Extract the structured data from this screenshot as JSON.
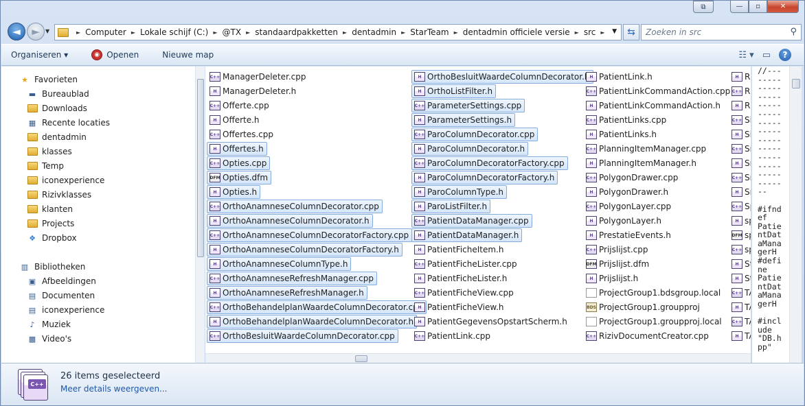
{
  "window": {
    "caption_buttons": {
      "restore_alt": "⧉",
      "minimize": "—",
      "maximize": "▫",
      "close": "✕"
    }
  },
  "nav": {
    "back_glyph": "◄",
    "forward_glyph": "►",
    "breadcrumb": [
      "Computer",
      "Lokale schijf (C:)",
      "@TX",
      "standaardpakketten",
      "dentadmin",
      "StarTeam",
      "dentadmin officiele versie",
      "src"
    ],
    "search_placeholder": "Zoeken in src"
  },
  "toolbar": {
    "organize_label": "Organiseren ▾",
    "open_label": "Openen",
    "new_folder_label": "Nieuwe map"
  },
  "navpane": {
    "favorites_header": "Favorieten",
    "favorites": [
      {
        "label": "Bureaublad",
        "icon": "desktop-icon"
      },
      {
        "label": "Downloads",
        "icon": "downloads-icon"
      },
      {
        "label": "Recente locaties",
        "icon": "recent-places-icon"
      },
      {
        "label": "dentadmin",
        "icon": "folder-icon"
      },
      {
        "label": "klasses",
        "icon": "folder-icon"
      },
      {
        "label": "Temp",
        "icon": "folder-icon"
      },
      {
        "label": "iconexperience",
        "icon": "folder-icon"
      },
      {
        "label": "Rizivklasses",
        "icon": "folder-icon"
      },
      {
        "label": "klanten",
        "icon": "folder-icon"
      },
      {
        "label": "Projects",
        "icon": "folder-icon"
      },
      {
        "label": "Dropbox",
        "icon": "dropbox-icon"
      }
    ],
    "libraries_header": "Bibliotheken",
    "libraries": [
      {
        "label": "Afbeeldingen",
        "icon": "pictures-icon"
      },
      {
        "label": "Documenten",
        "icon": "documents-icon"
      },
      {
        "label": "iconexperience",
        "icon": "documents-icon"
      },
      {
        "label": "Muziek",
        "icon": "music-icon"
      },
      {
        "label": "Video's",
        "icon": "video-icon"
      }
    ]
  },
  "files": {
    "col1": [
      {
        "name": "ManagerDeleter.cpp",
        "type": "cpp",
        "sel": false
      },
      {
        "name": "ManagerDeleter.h",
        "type": "h",
        "sel": false
      },
      {
        "name": "Offerte.cpp",
        "type": "cpp",
        "sel": false
      },
      {
        "name": "Offerte.h",
        "type": "h",
        "sel": false
      },
      {
        "name": "Offertes.cpp",
        "type": "cpp",
        "sel": false
      },
      {
        "name": "Offertes.h",
        "type": "h",
        "sel": true
      },
      {
        "name": "Opties.cpp",
        "type": "cpp",
        "sel": true
      },
      {
        "name": "Opties.dfm",
        "type": "dfm",
        "sel": true
      },
      {
        "name": "Opties.h",
        "type": "h",
        "sel": true
      },
      {
        "name": "OrthoAnamneseColumnDecorator.cpp",
        "type": "cpp",
        "sel": true
      },
      {
        "name": "OrthoAnamneseColumnDecorator.h",
        "type": "h",
        "sel": true
      },
      {
        "name": "OrthoAnamneseColumnDecoratorFactory.cpp",
        "type": "cpp",
        "sel": true
      },
      {
        "name": "OrthoAnamneseColumnDecoratorFactory.h",
        "type": "h",
        "sel": true
      },
      {
        "name": "OrthoAnamneseColumnType.h",
        "type": "h",
        "sel": true
      },
      {
        "name": "OrthoAnamneseRefreshManager.cpp",
        "type": "cpp",
        "sel": true
      },
      {
        "name": "OrthoAnamneseRefreshManager.h",
        "type": "h",
        "sel": true
      },
      {
        "name": "OrthoBehandelplanWaardeColumnDecorator.cpp",
        "type": "cpp",
        "sel": true
      },
      {
        "name": "OrthoBehandelplanWaardeColumnDecorator.h",
        "type": "h",
        "sel": true
      },
      {
        "name": "OrthoBesluitWaardeColumnDecorator.cpp",
        "type": "cpp",
        "sel": true
      }
    ],
    "col2": [
      {
        "name": "OrthoBesluitWaardeColumnDecorator.h",
        "type": "h",
        "sel": true
      },
      {
        "name": "OrthoListFilter.h",
        "type": "h",
        "sel": true
      },
      {
        "name": "ParameterSettings.cpp",
        "type": "cpp",
        "sel": true
      },
      {
        "name": "ParameterSettings.h",
        "type": "h",
        "sel": true
      },
      {
        "name": "ParoColumnDecorator.cpp",
        "type": "cpp",
        "sel": true
      },
      {
        "name": "ParoColumnDecorator.h",
        "type": "h",
        "sel": true
      },
      {
        "name": "ParoColumnDecoratorFactory.cpp",
        "type": "cpp",
        "sel": true
      },
      {
        "name": "ParoColumnDecoratorFactory.h",
        "type": "h",
        "sel": true
      },
      {
        "name": "ParoColumnType.h",
        "type": "h",
        "sel": true
      },
      {
        "name": "ParoListFilter.h",
        "type": "h",
        "sel": true
      },
      {
        "name": "PatientDataManager.cpp",
        "type": "cpp",
        "sel": true
      },
      {
        "name": "PatientDataManager.h",
        "type": "h",
        "sel": true
      },
      {
        "name": "PatientFicheItem.h",
        "type": "h",
        "sel": false
      },
      {
        "name": "PatientFicheLister.cpp",
        "type": "cpp",
        "sel": false
      },
      {
        "name": "PatientFicheLister.h",
        "type": "h",
        "sel": false
      },
      {
        "name": "PatientFicheView.cpp",
        "type": "cpp",
        "sel": false
      },
      {
        "name": "PatientFicheView.h",
        "type": "h",
        "sel": false
      },
      {
        "name": "PatientGegevensOpstartScherm.h",
        "type": "h",
        "sel": false
      },
      {
        "name": "PatientLink.cpp",
        "type": "cpp",
        "sel": false
      }
    ],
    "col3": [
      {
        "name": "PatientLink.h",
        "type": "h",
        "sel": false
      },
      {
        "name": "PatientLinkCommandAction.cpp",
        "type": "cpp",
        "sel": false
      },
      {
        "name": "PatientLinkCommandAction.h",
        "type": "h",
        "sel": false
      },
      {
        "name": "PatientLinks.cpp",
        "type": "cpp",
        "sel": false
      },
      {
        "name": "PatientLinks.h",
        "type": "h",
        "sel": false
      },
      {
        "name": "PlanningItemManager.cpp",
        "type": "cpp",
        "sel": false
      },
      {
        "name": "PlanningItemManager.h",
        "type": "h",
        "sel": false
      },
      {
        "name": "PolygonDrawer.cpp",
        "type": "cpp",
        "sel": false
      },
      {
        "name": "PolygonDrawer.h",
        "type": "h",
        "sel": false
      },
      {
        "name": "PolygonLayer.cpp",
        "type": "cpp",
        "sel": false
      },
      {
        "name": "PolygonLayer.h",
        "type": "h",
        "sel": false
      },
      {
        "name": "PrestatieEvents.h",
        "type": "h",
        "sel": false
      },
      {
        "name": "Prijslijst.cpp",
        "type": "cpp",
        "sel": false
      },
      {
        "name": "Prijslijst.dfm",
        "type": "dfm",
        "sel": false
      },
      {
        "name": "Prijslijst.h",
        "type": "h",
        "sel": false
      },
      {
        "name": "ProjectGroup1.bdsgroup.local",
        "type": "local",
        "sel": false
      },
      {
        "name": "ProjectGroup1.groupproj",
        "type": "groupproj",
        "sel": false
      },
      {
        "name": "ProjectGroup1.groupproj.local",
        "type": "local",
        "sel": false
      },
      {
        "name": "RizivDocumentCreator.cpp",
        "type": "cpp",
        "sel": false
      }
    ],
    "col4": [
      {
        "name": "Riz",
        "type": "h",
        "sel": false
      },
      {
        "name": "RX",
        "type": "cpp",
        "sel": false
      },
      {
        "name": "RX",
        "type": "h",
        "sel": false
      },
      {
        "name": "Sis",
        "type": "cpp",
        "sel": false
      },
      {
        "name": "Sis",
        "type": "h",
        "sel": false
      },
      {
        "name": "Sn",
        "type": "cpp",
        "sel": false
      },
      {
        "name": "Sn",
        "type": "h",
        "sel": false
      },
      {
        "name": "Sn",
        "type": "cpp",
        "sel": false
      },
      {
        "name": "Sn",
        "type": "h",
        "sel": false
      },
      {
        "name": "Sp",
        "type": "cpp",
        "sel": false
      },
      {
        "name": "sp",
        "type": "h",
        "sel": false
      },
      {
        "name": "sp",
        "type": "dfm",
        "sel": false
      },
      {
        "name": "sp",
        "type": "cpp",
        "sel": false
      },
      {
        "name": "Sto",
        "type": "h",
        "sel": false
      },
      {
        "name": "Sto",
        "type": "h",
        "sel": false
      },
      {
        "name": "TA",
        "type": "cpp",
        "sel": false
      },
      {
        "name": "TA",
        "type": "h",
        "sel": false
      },
      {
        "name": "TA",
        "type": "cpp",
        "sel": false
      },
      {
        "name": "TA",
        "type": "h",
        "sel": false
      }
    ]
  },
  "preview_text": "//---\n-----\n-----\n-----\n-----\n-----\n-----\n-----\n-----\n-----\n-----\n-----\n-----\n-----\n--\n\n#ifnd\nef\nPatie\nntDat\naMana\ngerH\n#defi\nne\nPatie\nntDat\naMana\ngerH\n\n#incl\nude\n\"DB.h\npp\"",
  "details": {
    "title": "26 items geselecteerd",
    "more_link": "Meer details weergeven...",
    "badge": "C++"
  }
}
